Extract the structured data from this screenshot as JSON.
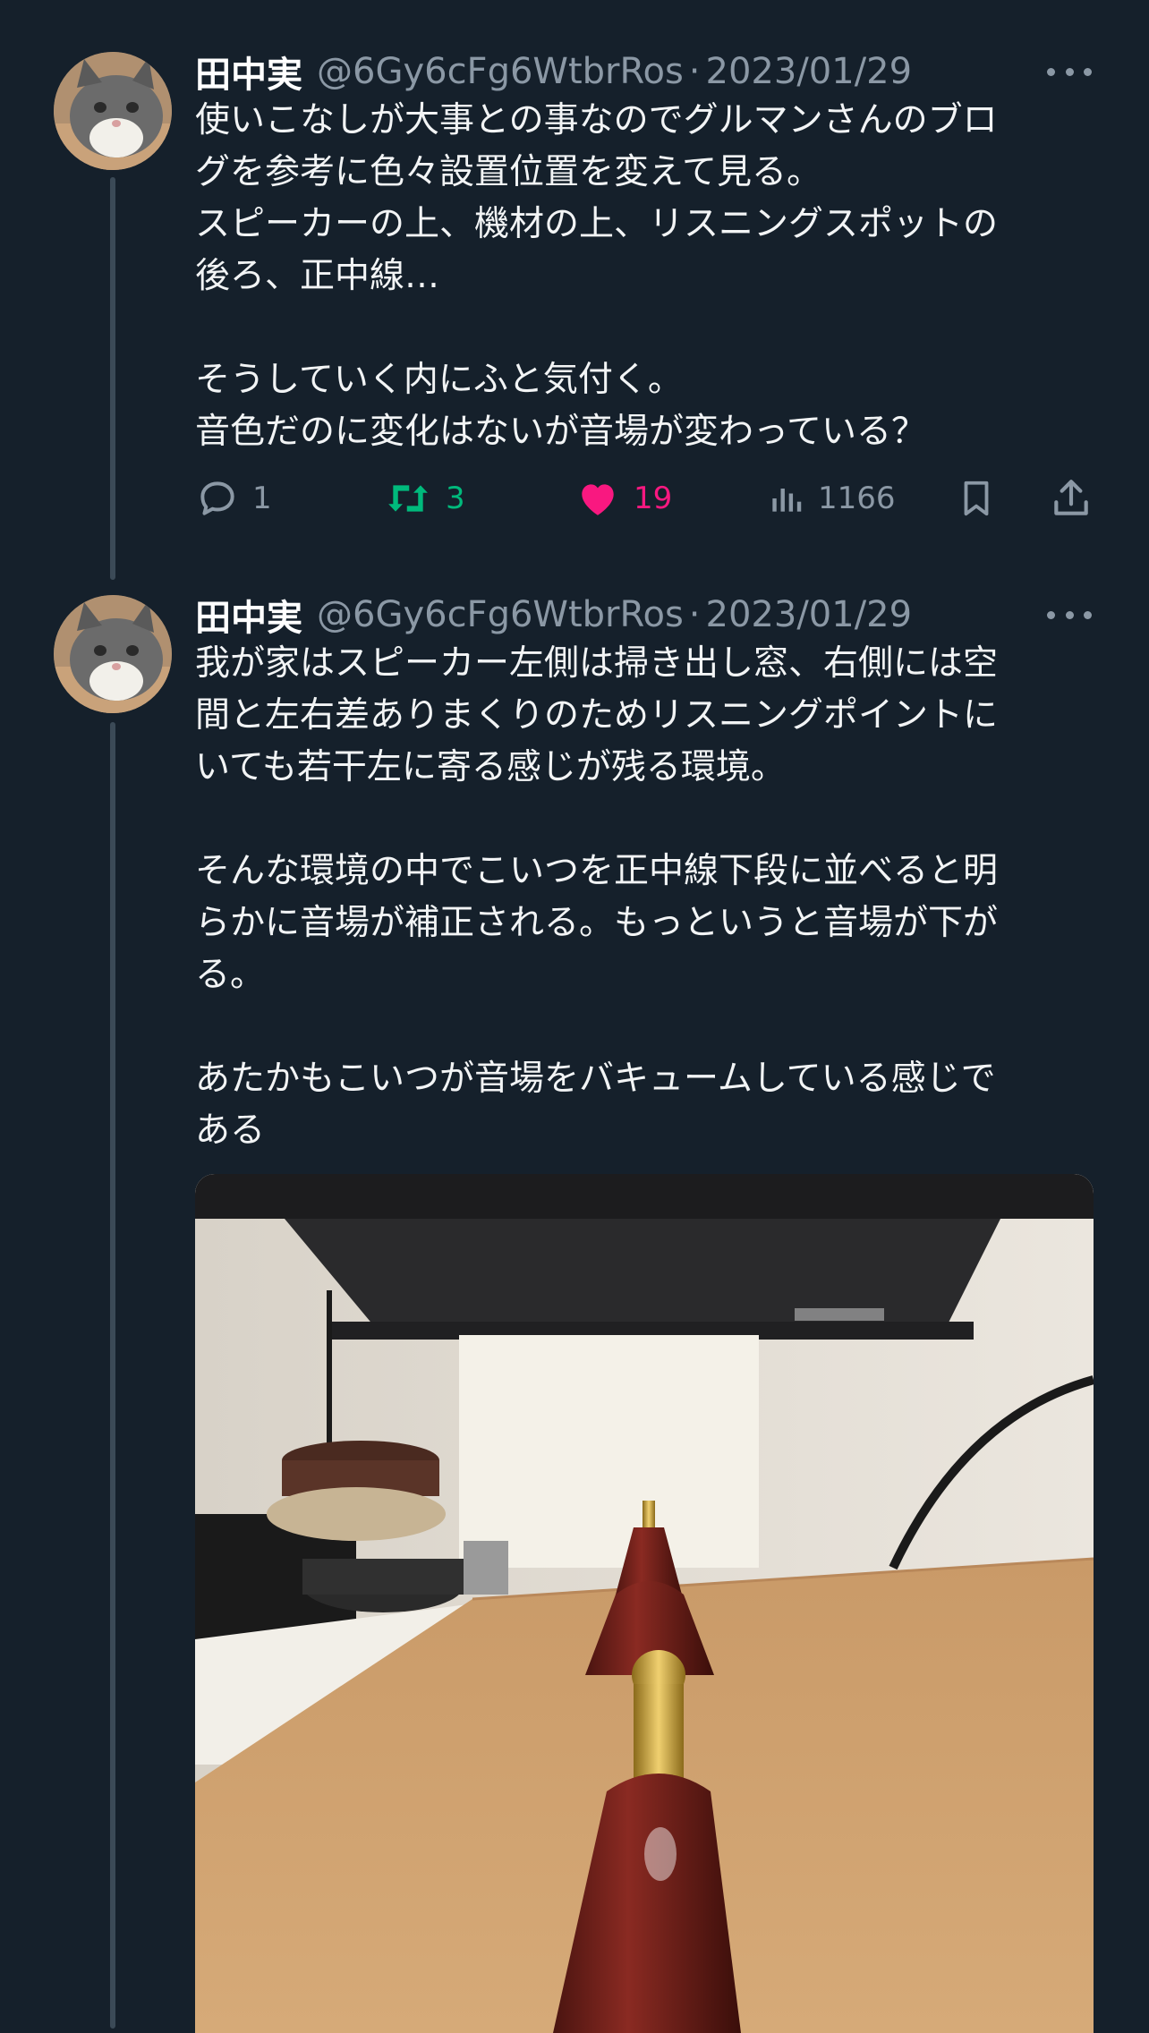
{
  "tweets": [
    {
      "author_name": "田中実",
      "handle": "@6Gy6cFg6WtbrRos",
      "separator": "·",
      "date": "2023/01/29",
      "text": "使いこなしが大事との事なのでグルマンさんのブロ\nグを参考に色々設置位置を変えて見る。\nスピーカーの上、機材の上、リスニングスポットの\n後ろ、正中線…\n\nそうしていく内にふと気付く。\n音色だのに変化はないが音場が変わっている？",
      "stats": {
        "replies": "1",
        "retweets": "3",
        "likes": "19",
        "views": "1166"
      }
    },
    {
      "author_name": "田中実",
      "handle": "@6Gy6cFg6WtbrRos",
      "separator": "·",
      "date": "2023/01/29",
      "text": "我が家はスピーカー左側は掃き出し窓、右側には空\n間と左右差ありまくりのためリスニングポイントに\nいても若干左に寄る感じが残る環境。\n\nそんな環境の中でこいつを正中線下段に並べると明\nらかに音場が補正される。もっというと音場が下が\nる。\n\nあたかもこいつが音場をバキュームしている感じで\nある"
    }
  ],
  "colors": {
    "background": "#15202b",
    "secondary_text": "#8b98a5",
    "retweet_active": "#00ba7c",
    "like_active": "#f91880"
  },
  "icons": [
    "avatar-cat",
    "more-icon",
    "reply-icon",
    "retweet-icon",
    "heart-icon",
    "views-icon",
    "bookmark-icon",
    "share-icon"
  ]
}
